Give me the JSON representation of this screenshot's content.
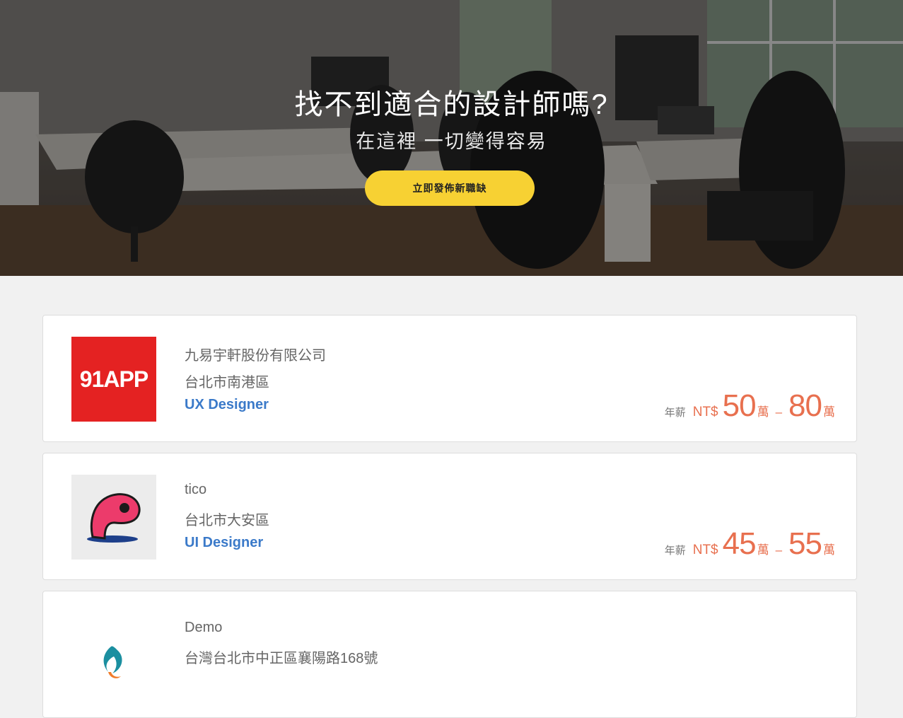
{
  "hero": {
    "title": "找不到適合的設計師嗎?",
    "subtitle": "在這裡 一切變得容易",
    "cta_label": "立即發佈新職缺"
  },
  "jobs": [
    {
      "company": "九易宇軒股份有限公司",
      "location": "台北市南港區",
      "role": "UX Designer",
      "logo_text": "91APP",
      "logo_color": "#e42222",
      "salary_label": "年薪",
      "currency": "NT$",
      "salary_min": "50",
      "salary_max": "80",
      "unit": "萬",
      "dash": "–"
    },
    {
      "company": "tico",
      "location": "台北市大安區",
      "role": "UI Designer",
      "logo_icon": "pink-creature-icon",
      "logo_color": "#ec3b6b",
      "salary_label": "年薪",
      "currency": "NT$",
      "salary_min": "45",
      "salary_max": "55",
      "unit": "萬",
      "dash": "–"
    },
    {
      "company": "Demo",
      "location": "台灣台北市中正區襄陽路168號",
      "logo_icon": "flame-icon"
    }
  ],
  "colors": {
    "accent_yellow": "#f7d133",
    "salary_orange": "#e8704f",
    "role_blue": "#3b7ac9"
  }
}
